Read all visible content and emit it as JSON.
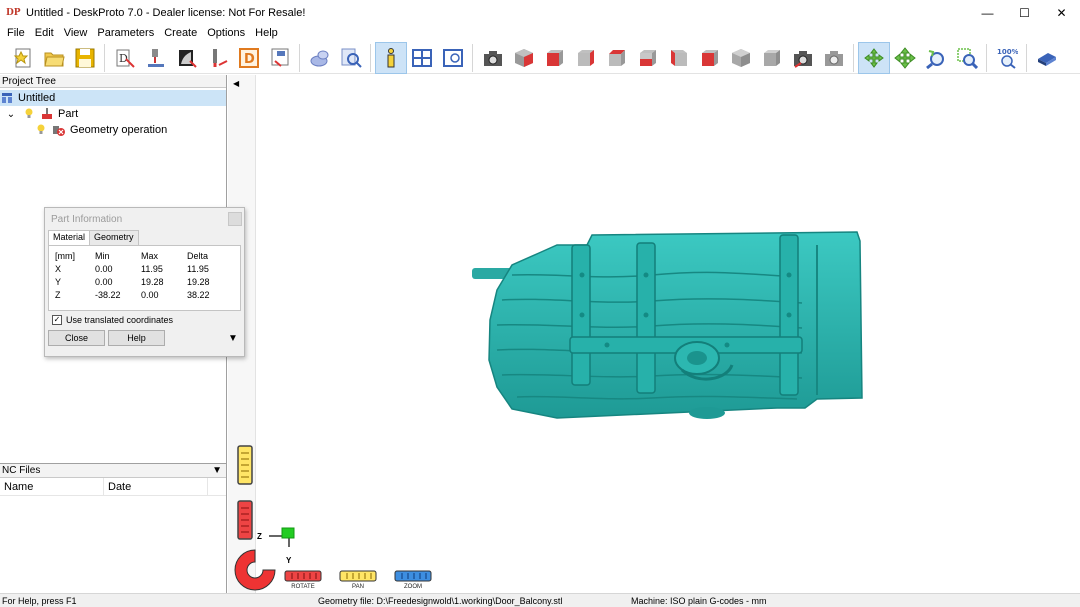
{
  "window": {
    "title": "Untitled - DeskProto 7.0 - Dealer license: Not For Resale!",
    "app_icon": "DP",
    "minimize": "—",
    "maximize": "☐",
    "close": "✕"
  },
  "menu": [
    "File",
    "Edit",
    "View",
    "Parameters",
    "Create",
    "Options",
    "Help"
  ],
  "toolbar": {
    "zoom_level": "100%"
  },
  "project_tree": {
    "header": "Project Tree",
    "root": "Untitled",
    "part": "Part",
    "operation": "Geometry operation"
  },
  "nc_files": {
    "header": "NC Files",
    "col_name": "Name",
    "col_date": "Date"
  },
  "dialog": {
    "title": "Part Information",
    "tabs": [
      "Material",
      "Geometry"
    ],
    "headers": [
      "[mm]",
      "Min",
      "Max",
      "Delta"
    ],
    "rows": [
      [
        "X",
        "0.00",
        "11.95",
        "11.95"
      ],
      [
        "Y",
        "0.00",
        "19.28",
        "19.28"
      ],
      [
        "Z",
        "-38.22",
        "0.00",
        "38.22"
      ]
    ],
    "checkbox_label": "Use translated coordinates",
    "checkbox_checked": "✓",
    "close": "Close",
    "help": "Help",
    "more": "▼"
  },
  "viewport": {
    "axis_z": "Z",
    "axis_y": "Y",
    "rotate_label": "ROTATE",
    "pan_label": "PAN",
    "zoom_label": "ZOOM",
    "model_color": "#2cb7b0"
  },
  "status": {
    "help": "For Help, press F1",
    "geometry_file": "Geometry file: D:\\Freedesignwold\\1.working\\Door_Balcony.stl",
    "machine": "Machine: ISO plain G-codes - mm"
  },
  "collapse_arrow": "◀"
}
